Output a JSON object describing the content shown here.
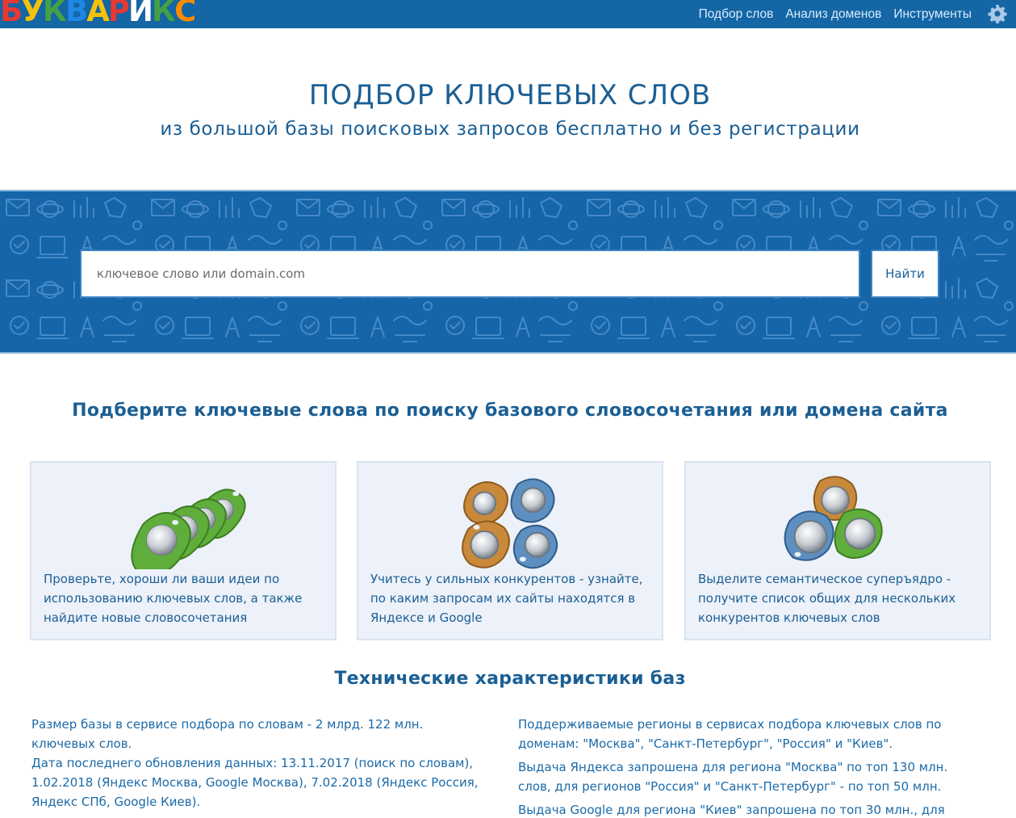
{
  "header": {
    "logo_letters": [
      {
        "char": "Б",
        "color": "#e53935"
      },
      {
        "char": "у",
        "color": "#f4c20d"
      },
      {
        "char": "К",
        "color": "#43a047"
      },
      {
        "char": "в",
        "color": "#1e88e5"
      },
      {
        "char": "А",
        "color": "#f4c20d"
      },
      {
        "char": "р",
        "color": "#e53935"
      },
      {
        "char": "И",
        "color": "#ffffff"
      },
      {
        "char": "к",
        "color": "#43a047"
      },
      {
        "char": "С",
        "color": "#fb8c00"
      }
    ],
    "nav": [
      {
        "label": "Подбор слов"
      },
      {
        "label": "Анализ доменов"
      },
      {
        "label": "Инструменты"
      }
    ],
    "settings_icon": "gear-icon"
  },
  "hero": {
    "title": "ПОДБОР КЛЮЧЕВЫХ СЛОВ",
    "subtitle": "из большой базы поисковых запросов бесплатно и без регистрации"
  },
  "search": {
    "placeholder": "ключевое слово или domain.com",
    "value": "",
    "button_label": "Найти"
  },
  "features": {
    "title": "Подберите ключевые слова по поиску базового словосочетания или домена сайта",
    "cards": [
      {
        "icon": "green-keyfobs-icon",
        "text": "Проверьте, хороши ли ваши идеи по использованию ключевых слов, а также найдите новые словосочетания"
      },
      {
        "icon": "competitor-keyfobs-icon",
        "text": "Учитесь у сильных конкурентов - узнайте, по каким запросам их сайты находятся в Яндексе и Google"
      },
      {
        "icon": "core-keyfobs-icon",
        "text": "Выделите семантическое суперъядро - получите список общих для нескольких конкурентов ключевых слов"
      }
    ]
  },
  "specs": {
    "title": "Технические характеристики баз",
    "left": [
      "Размер базы в сервисе подбора по словам - 2 млрд. 122 млн. ключевых слов.",
      "Дата последнего обновления данных: 13.11.2017 (поиск по словам), 1.02.2018 (Яндекс Москва, Google Москва), 7.02.2018 (Яндекс Россия, Яндекс СПб, Google Киев)."
    ],
    "right": [
      "Поддерживаемые регионы в сервисах подбора ключевых слов по доменам: \"Москва\", \"Санкт-Петербург\", \"Россия\" и \"Киев\".",
      "Выдача Яндекса запрошена для региона \"Москва\" по топ 130 млн. слов, для регионов \"Россия\" и \"Санкт-Петербург\" - по топ 50 млн.",
      "Выдача Google для региона \"Киев\" запрошена по топ 30 млн., для"
    ]
  }
}
